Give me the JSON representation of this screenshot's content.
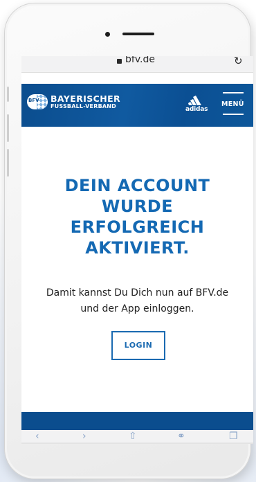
{
  "browser": {
    "url": "bfv.de",
    "reload_icon": "reload-icon",
    "lock_icon": "lock-icon"
  },
  "header": {
    "logo_badge": "BFV",
    "logo_line1": "BAYERISCHER",
    "logo_line2": "FUSSBALL-VERBAND",
    "sponsor": "adidas",
    "menu_label": "MENÜ"
  },
  "main": {
    "headline": [
      "DEIN ACCOUNT",
      "WURDE",
      "ERFOLGREICH",
      "AKTIVIERT."
    ],
    "info": [
      "Damit kannst Du Dich nun auf BFV.de",
      "und der App einloggen."
    ],
    "login_label": "LOGIN"
  },
  "toolbar": {
    "icons": [
      "back-icon",
      "forward-icon",
      "share-icon",
      "bookmarks-icon",
      "tabs-icon"
    ]
  },
  "colors": {
    "brand_blue": "#0b4d8e",
    "headline_blue": "#1469b3",
    "button_blue": "#1a6ab1"
  }
}
